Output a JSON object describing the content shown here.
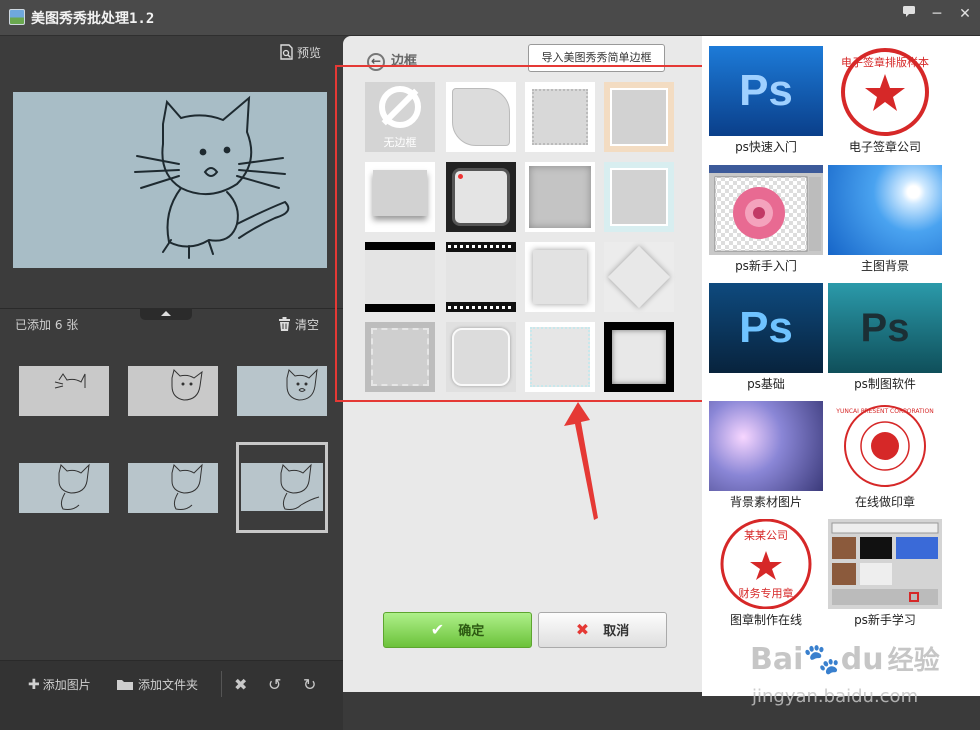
{
  "window": {
    "title": "美图秀秀批处理1.2",
    "buttons": [
      "feedback",
      "minimize",
      "close"
    ]
  },
  "left_panel": {
    "preview_label": "预览",
    "added_count": "已添加 6 张",
    "clear_label": "清空",
    "thumbnails": 6,
    "selected_thumbnail": 6
  },
  "toolbar": {
    "add_image": "添加图片",
    "add_folder": "添加文件夹"
  },
  "dialog": {
    "title": "边框",
    "import_button": "导入美图秀秀简单边框",
    "no_border_label": "无边框",
    "frames": 16,
    "ok": "确定",
    "cancel": "取消"
  },
  "ads": [
    {
      "caption": "ps快速入门",
      "icon": "ps-logo"
    },
    {
      "caption": "电子签章公司",
      "icon": "red-stamp"
    },
    {
      "caption": "ps新手入门",
      "icon": "photoshop-flower"
    },
    {
      "caption": "主图背景",
      "icon": "blue-sky"
    },
    {
      "caption": "ps基础",
      "icon": "ps-logo"
    },
    {
      "caption": "ps制图软件",
      "icon": "ps-logo"
    },
    {
      "caption": "背景素材图片",
      "icon": "bokeh"
    },
    {
      "caption": "在线做印章",
      "icon": "red-stamp"
    },
    {
      "caption": "图章制作在线",
      "icon": "red-stamp"
    },
    {
      "caption": "ps新手学习",
      "icon": "photoshop-ui"
    }
  ],
  "ad_texts": {
    "ps": "Ps",
    "stamp1_text": "电子签章排版样本",
    "stamp2_text": "YUNCAI PRESENT CORPORATION",
    "stamp3_top": "某某公司",
    "stamp3_bottom": "财务专用章"
  },
  "watermark": {
    "brand": "Bai",
    "brand2": "du",
    "suffix": "经验",
    "url": "jingyan.baidu.com"
  },
  "colors": {
    "highlight": "#e53935",
    "ok_green": "#7ccf45",
    "stamp_red": "#d62828"
  }
}
